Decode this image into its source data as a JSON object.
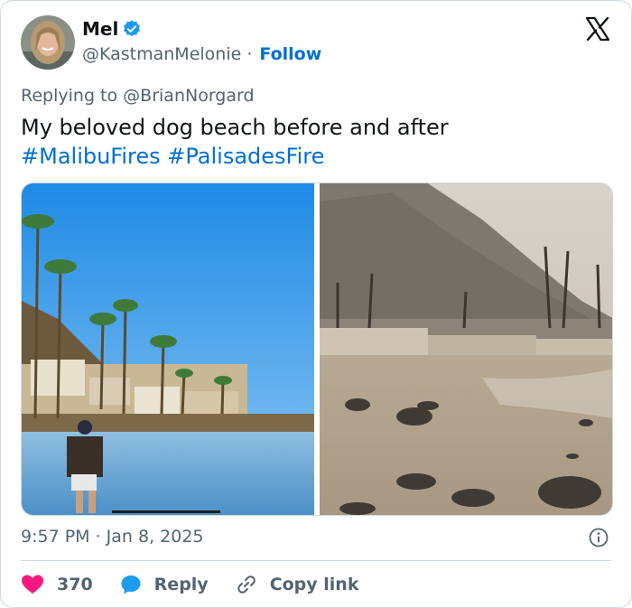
{
  "author": {
    "name": "Mel",
    "handle": "@KastmanMelonie",
    "separator": "·",
    "follow_label": "Follow"
  },
  "replying": {
    "prefix": "Replying to",
    "user": "@BrianNorgard"
  },
  "tweet": {
    "text_line1": "My beloved dog beach before and after",
    "hashtag1": "#MalibuFires",
    "hashtag2": "#PalisadesFire"
  },
  "timestamp": "9:57 PM · Jan 8, 2025",
  "actions": {
    "like_count": "370",
    "reply_label": "Reply",
    "copy_label": "Copy link"
  },
  "colors": {
    "link": "#006fd6",
    "verified": "#1d9bf0",
    "like": "#f91880",
    "text_secondary": "#536471"
  },
  "icons": [
    "verified-badge-icon",
    "x-logo-icon",
    "info-icon",
    "heart-icon",
    "reply-bubble-icon",
    "link-icon"
  ]
}
